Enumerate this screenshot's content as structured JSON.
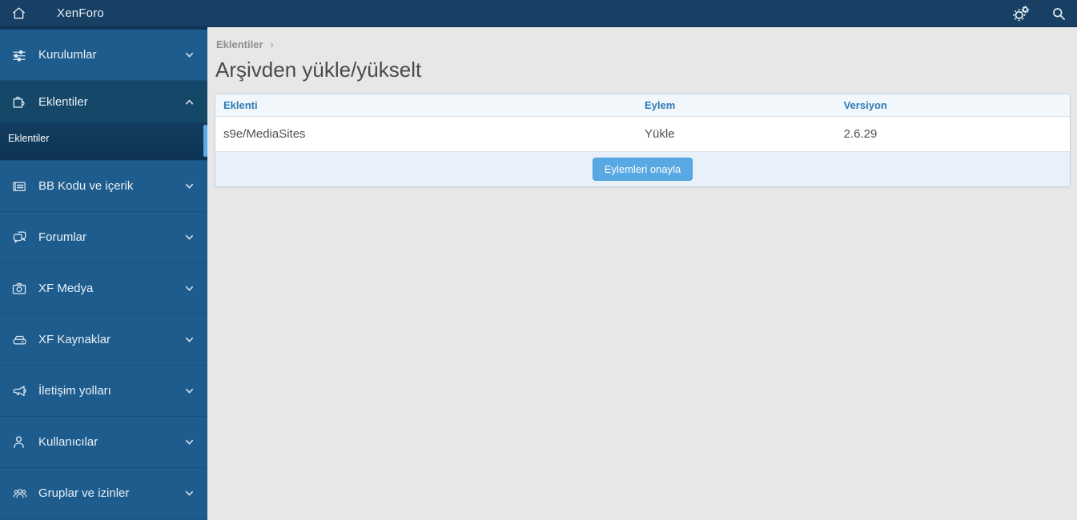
{
  "topbar": {
    "title": "XenForo",
    "icons": [
      "home-icon",
      "cogs-icon",
      "search-icon"
    ]
  },
  "sidebar": {
    "items": [
      {
        "label": "Kurulumlar",
        "icon": "sliders-icon",
        "chevron": "down",
        "expanded": false
      },
      {
        "label": "Eklentiler",
        "icon": "puzzle-icon",
        "chevron": "up",
        "expanded": true,
        "children": [
          {
            "label": "Eklentiler",
            "active": true
          }
        ]
      },
      {
        "label": "BB Kodu ve içerik",
        "icon": "bbcode-card-icon",
        "chevron": "down",
        "expanded": false
      },
      {
        "label": "Forumlar",
        "icon": "forums-icon",
        "chevron": "down",
        "expanded": false
      },
      {
        "label": "XF Medya",
        "icon": "camera-icon",
        "chevron": "down",
        "expanded": false
      },
      {
        "label": "XF Kaynaklar",
        "icon": "drive-icon",
        "chevron": "down",
        "expanded": false
      },
      {
        "label": "İletişim yolları",
        "icon": "megaphone-icon",
        "chevron": "down",
        "expanded": false
      },
      {
        "label": "Kullanıcılar",
        "icon": "user-icon",
        "chevron": "down",
        "expanded": false
      },
      {
        "label": "Gruplar ve izinler",
        "icon": "users-icon",
        "chevron": "down",
        "expanded": false
      }
    ]
  },
  "main": {
    "breadcrumb": {
      "items": [
        "Eklentiler"
      ],
      "separator": "›"
    },
    "page_title": "Arşivden yükle/yükselt",
    "table": {
      "columns": [
        "Eklenti",
        "Eylem",
        "Versiyon"
      ],
      "rows": [
        {
          "eklenti": "s9e/MediaSites",
          "eylem": "Yükle",
          "versiyon": "2.6.29"
        }
      ],
      "confirm_button_label": "Eylemleri onayla"
    }
  },
  "colors": {
    "topbar_bg": "#174064",
    "sidebar_bg": "#1e5c8d",
    "sidebar_expanded_bg": "#154769",
    "submenu_bg": "#113a5c",
    "scroll_thumb": "#5aaae8",
    "main_bg": "#e7e7e7",
    "table_header_text": "#2d7ab4",
    "table_footer_bg": "#e8f1f9",
    "button_bg": "#58a8e3"
  }
}
